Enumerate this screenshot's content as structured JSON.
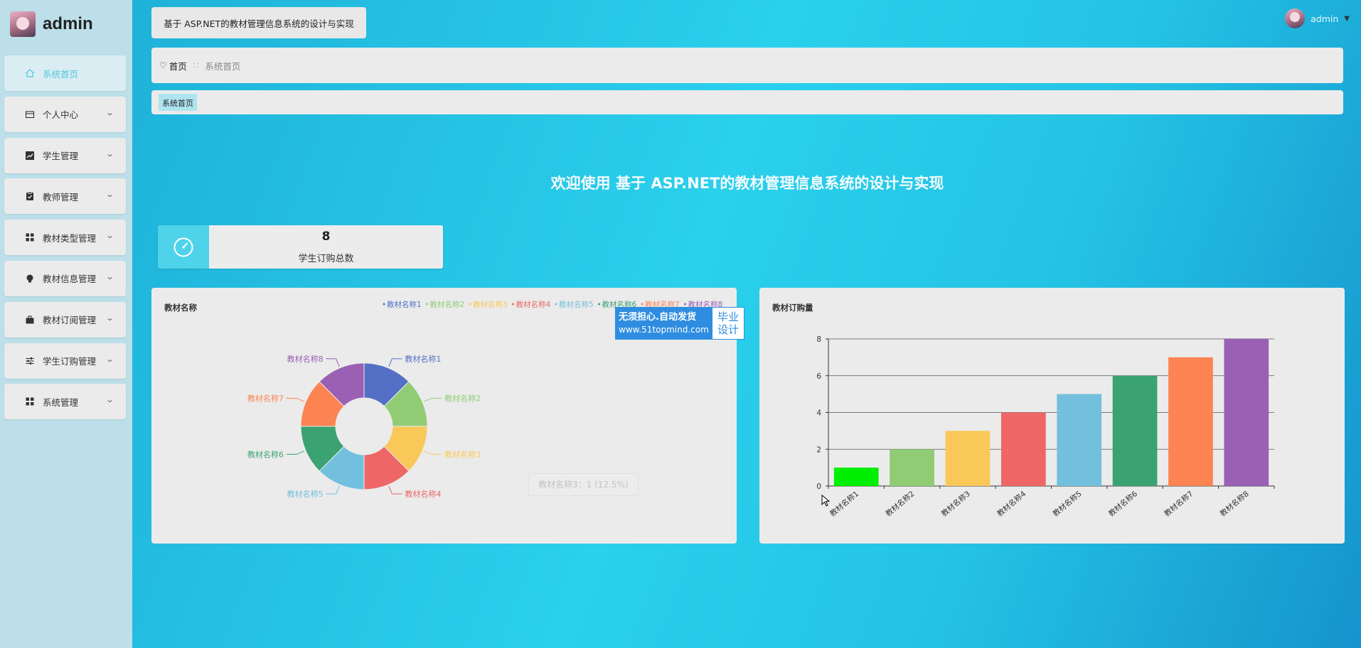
{
  "app": {
    "brand": "admin",
    "title": "基于 ASP.NET的教材管理信息系统的设计与实现"
  },
  "user": {
    "name": "admin"
  },
  "sidebar": {
    "items": [
      {
        "label": "系统首页",
        "icon": "home-icon",
        "active": true
      },
      {
        "label": "个人中心",
        "icon": "wallet-icon"
      },
      {
        "label": "学生管理",
        "icon": "trend-icon"
      },
      {
        "label": "教师管理",
        "icon": "clipboard-icon"
      },
      {
        "label": "教材类型管理",
        "icon": "grid-icon"
      },
      {
        "label": "教材信息管理",
        "icon": "bulb-icon"
      },
      {
        "label": "教材订阅管理",
        "icon": "briefcase-icon"
      },
      {
        "label": "学生订购管理",
        "icon": "sliders-icon"
      },
      {
        "label": "系统管理",
        "icon": "grid-icon"
      }
    ]
  },
  "breadcrumb": {
    "home": "首页",
    "separator": "::",
    "current": "系统首页"
  },
  "tags": {
    "active": "系统首页"
  },
  "welcome": "欢迎使用 基于 ASP.NET的教材管理信息系统的设计与实现",
  "stat": {
    "value": "8",
    "label": "学生订购总数"
  },
  "watermark": {
    "line1": "无须担心.自动发货",
    "line2": "www.51topmind.com",
    "badge1": "毕业",
    "badge2": "设计"
  },
  "tooltip": "教材名称3：1 (12.5%)",
  "chart_data": [
    {
      "type": "pie",
      "title": "教材名称",
      "donut": true,
      "legend": "top-right",
      "categories": [
        "教材名称1",
        "教材名称2",
        "教材名称3",
        "教材名称4",
        "教材名称5",
        "教材名称6",
        "教材名称7",
        "教材名称8"
      ],
      "values": [
        1,
        1,
        1,
        1,
        1,
        1,
        1,
        1
      ],
      "colors": [
        "#5470c6",
        "#91cc75",
        "#fac858",
        "#ee6666",
        "#73c0de",
        "#3ba272",
        "#fc8452",
        "#9a60b4"
      ]
    },
    {
      "type": "bar",
      "title": "教材订购量",
      "categories": [
        "教材名称1",
        "教材名称2",
        "教材名称3",
        "教材名称4",
        "教材名称5",
        "教材名称6",
        "教材名称7",
        "教材名称8"
      ],
      "values": [
        1,
        2,
        3,
        4,
        5,
        6,
        7,
        8
      ],
      "colors": [
        "#00ee00",
        "#91cc75",
        "#fac858",
        "#ee6666",
        "#73c0de",
        "#3ba272",
        "#fc8452",
        "#9a60b4"
      ],
      "ylim": [
        0,
        8
      ],
      "yticks": [
        0,
        2,
        4,
        6,
        8
      ],
      "grid": true
    }
  ]
}
